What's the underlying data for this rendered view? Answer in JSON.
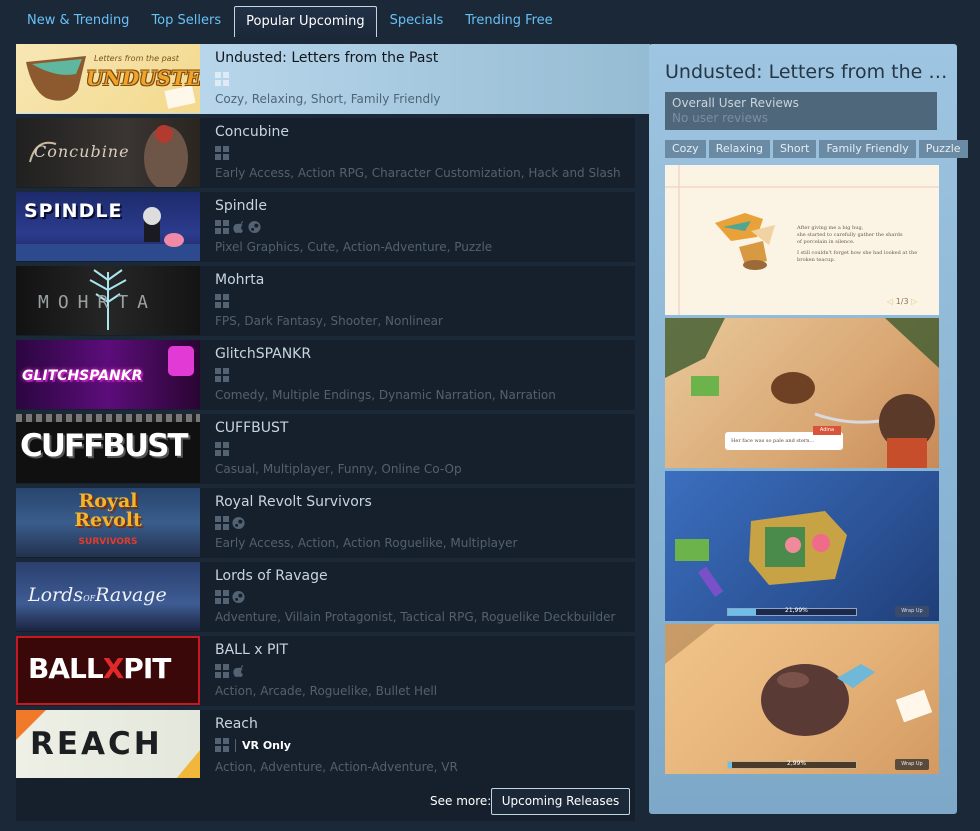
{
  "tabs": [
    {
      "label": "New & Trending"
    },
    {
      "label": "Top Sellers"
    },
    {
      "label": "Popular Upcoming"
    },
    {
      "label": "Specials"
    },
    {
      "label": "Trending Free"
    }
  ],
  "games": [
    {
      "title": "Undusted: Letters from the Past",
      "tags": "Cozy, Relaxing, Short, Family Friendly",
      "logo": "UNDUSTED",
      "logo_sub": "Letters from the past"
    },
    {
      "title": "Concubine",
      "tags": "Early Access, Action RPG, Character Customization, Hack and Slash",
      "logo": "Concubine"
    },
    {
      "title": "Spindle",
      "tags": "Pixel Graphics, Cute, Action-Adventure, Puzzle",
      "logo": "SPINDLE"
    },
    {
      "title": "Mohrta",
      "tags": "FPS, Dark Fantasy, Shooter, Nonlinear",
      "logo": "MOHRTA"
    },
    {
      "title": "GlitchSPANKR",
      "tags": "Comedy, Multiple Endings, Dynamic Narration, Narration",
      "logo": "GLITCHSPANKR"
    },
    {
      "title": "CUFFBUST",
      "tags": "Casual, Multiplayer, Funny, Online Co-Op",
      "logo": "CUFFBUST"
    },
    {
      "title": "Royal Revolt Survivors",
      "tags": "Early Access, Action, Action Roguelike, Multiplayer",
      "logo": "Royal",
      "logo_2": "Revolt",
      "logo_sub": "SURVIVORS"
    },
    {
      "title": "Lords of Ravage",
      "tags": "Adventure, Villain Protagonist, Tactical RPG, Roguelike Deckbuilder",
      "logo": "Lords",
      "logo_2": "Ravage",
      "logo_mid": "OF"
    },
    {
      "title": "BALL x PIT",
      "tags": "Action, Arcade, Roguelike, Bullet Hell",
      "logo": "BALL",
      "logo_2": "PIT",
      "logo_x": "X"
    },
    {
      "title": "Reach",
      "tags": "Action, Adventure, Action-Adventure, VR",
      "logo": "REACH",
      "vr_label": "VR Only"
    }
  ],
  "see_more": {
    "label": "See more:",
    "button": "Upcoming Releases"
  },
  "panel": {
    "title": "Undusted: Letters from the Past",
    "reviews_label": "Overall User Reviews",
    "reviews_value": "No user reviews",
    "tags": [
      "Cozy",
      "Relaxing",
      "Short",
      "Family Friendly",
      "Puzzle"
    ],
    "shot1_text1": "After giving me a big hug,",
    "shot1_text2": "she started to carefully gather the shards",
    "shot1_text3": "of porcelain in silence.",
    "shot1_text4": "I still couldn't forget how she had looked at the",
    "shot1_text5": "broken teacup.",
    "shot1_page": "1/3",
    "shot2_dialog": "Her face was so pale and stern...",
    "shot2_name": "Adina",
    "shot3_progress": "21,99%",
    "shot3_button": "Wrap Up",
    "shot4_progress": "2,99%",
    "shot4_button": "Wrap Up"
  }
}
